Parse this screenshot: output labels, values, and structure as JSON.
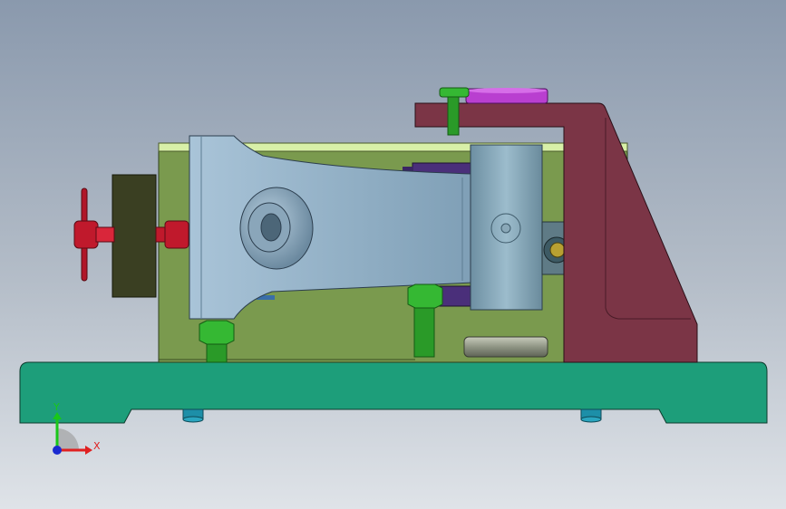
{
  "viewport": {
    "background_top": "#8a99ad",
    "background_bottom": "#dfe3e8"
  },
  "parts": [
    {
      "name": "base-plate",
      "color": "#1d9e7a"
    },
    {
      "name": "body-plate",
      "color": "#7a9a4e"
    },
    {
      "name": "top-rail",
      "color": "#d8f0a8"
    },
    {
      "name": "support-bracket",
      "color": "#7b3546"
    },
    {
      "name": "swing-arm",
      "color": "#8fb0c8"
    },
    {
      "name": "pivot-cylinder",
      "color": "#7ea0b2"
    },
    {
      "name": "clamp-block",
      "color": "#3a3f22"
    },
    {
      "name": "handwheel",
      "color": "#c0192c"
    },
    {
      "name": "hex-bolts",
      "color": "#35b833"
    },
    {
      "name": "locating-pins",
      "color": "#1d8fa8"
    },
    {
      "name": "top-cam",
      "color": "#b93fd0"
    },
    {
      "name": "guide-blocks",
      "color": "#4a2f7a"
    },
    {
      "name": "bushing",
      "color": "#5f7b86"
    },
    {
      "name": "spacer-disc",
      "color": "#9aa08e"
    }
  ],
  "triad": {
    "x_label": "X",
    "y_label": "Y",
    "x_color": "#e02020",
    "y_color": "#19c719",
    "z_color": "#1a2ad0"
  }
}
